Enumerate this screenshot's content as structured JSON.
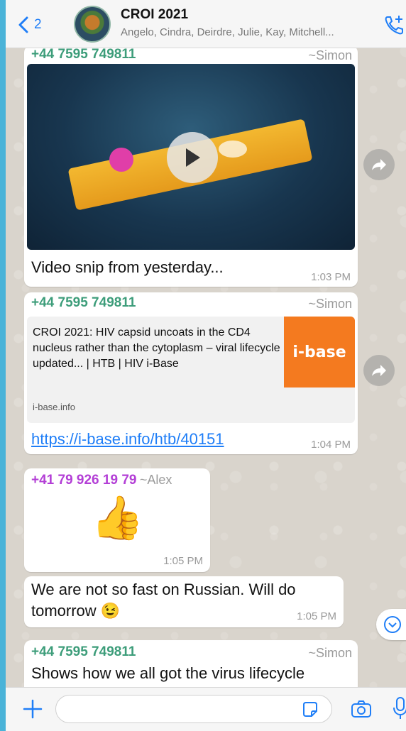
{
  "header": {
    "back_chevron": "<",
    "back_count": "2",
    "title": "CROI 2021",
    "subtitle": "Angelo, Cindra, Deirdre, Julie, Kay, Mitchell..."
  },
  "messages": [
    {
      "sender": "+44 7595 749811",
      "pushname": "~Simon",
      "caption": "Video snip from yesterday...",
      "time": "1:03 PM"
    },
    {
      "sender": "+44 7595 749811",
      "pushname": "~Simon",
      "link_title": "CROI 2021: HIV capsid uncoats in the CD4 nucleus rather than the cytoplasm – viral lifecycle updated... | HTB | HIV i-Base",
      "link_domain": "i-base.info",
      "link_logo": "i-base",
      "url": "https://i-base.info/htb/40151",
      "time": "1:04 PM"
    },
    {
      "sender": "+41 79 926 19 79",
      "pushname": "~Alex",
      "emoji": "👍",
      "time": "1:05 PM"
    },
    {
      "text_line1": "We are not so fast on Russian. Will do",
      "text_line2": "tomorrow 😉",
      "time": "1:05 PM"
    },
    {
      "sender": "+44 7595 749811",
      "pushname": "~Simon",
      "text": "Shows how we all got the virus lifecycle"
    }
  ],
  "colors": {
    "accent": "#1f7ef7",
    "sender_green": "#3d9d7a",
    "sender_purple": "#b33fd6",
    "ibase_orange": "#f47a1f"
  },
  "icons": [
    "back-chevron-icon",
    "group-call-icon",
    "forward-icon",
    "play-icon",
    "scroll-down-icon",
    "plus-icon",
    "sticker-icon",
    "camera-icon",
    "mic-icon"
  ]
}
